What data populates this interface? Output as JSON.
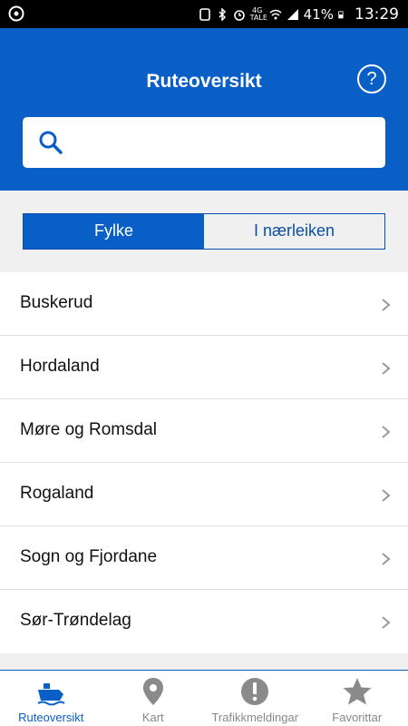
{
  "statusbar": {
    "network": "4G",
    "network_sub": "TALE",
    "battery_pct": "41%",
    "time": "13:29"
  },
  "header": {
    "title": "Ruteoversikt",
    "help_icon": "?"
  },
  "search": {
    "value": "",
    "placeholder": ""
  },
  "segment": {
    "options": [
      "Fylke",
      "I nærleiken"
    ],
    "selected": "Fylke"
  },
  "list": {
    "items": [
      "Buskerud",
      "Hordaland",
      "Møre og Romsdal",
      "Rogaland",
      "Sogn og Fjordane",
      "Sør-Trøndelag"
    ]
  },
  "bottomnav": {
    "tabs": [
      {
        "label": "Ruteoversikt",
        "icon": "ferry-icon"
      },
      {
        "label": "Kart",
        "icon": "map-pin-icon"
      },
      {
        "label": "Trafikkmeldingar",
        "icon": "alert-icon"
      },
      {
        "label": "Favorittar",
        "icon": "star-icon"
      }
    ],
    "selected": "Ruteoversikt"
  },
  "colors": {
    "brand": "#0a5fc7",
    "inactive_tab": "#888888",
    "background": "#f0f0f0"
  }
}
